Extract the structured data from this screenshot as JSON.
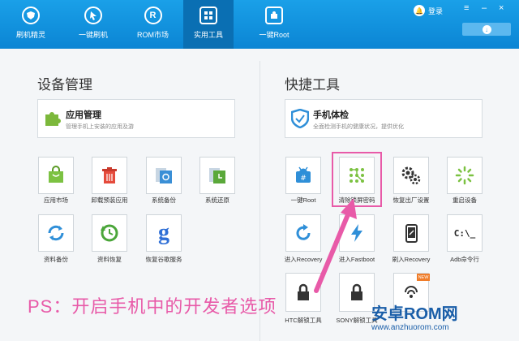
{
  "nav": [
    {
      "label": "刷机精灵",
      "icon": "shield-icon"
    },
    {
      "label": "一键刷机",
      "icon": "cursor-icon"
    },
    {
      "label": "ROM市场",
      "icon": "rom-icon",
      "glyph": "R"
    },
    {
      "label": "实用工具",
      "icon": "grid-icon",
      "active": true
    },
    {
      "label": "一键Root",
      "icon": "root-icon"
    }
  ],
  "header": {
    "login_label": "登录",
    "win_menu": "≡",
    "win_min": "–",
    "win_close": "×"
  },
  "device_mgmt": {
    "title": "设备管理",
    "card": {
      "title": "应用管理",
      "desc": "管理手机上安装的应用及游"
    },
    "tiles": [
      {
        "label": "应用市场",
        "icon": "shopping-bag-icon"
      },
      {
        "label": "卸载预装应用",
        "icon": "trash-icon"
      },
      {
        "label": "系统备份",
        "icon": "system-backup-icon"
      },
      {
        "label": "系统还原",
        "icon": "system-restore-icon"
      },
      {
        "label": "资料备份",
        "icon": "sync-icon"
      },
      {
        "label": "资料恢复",
        "icon": "history-icon"
      },
      {
        "label": "恢复谷歌服务",
        "icon": "google-icon"
      }
    ]
  },
  "quick_tools": {
    "title": "快捷工具",
    "card": {
      "title": "手机体检",
      "desc": "全面检测手机的健康状况，提供优化"
    },
    "tiles": [
      {
        "label": "一键Root",
        "icon": "android-root-icon"
      },
      {
        "label": "清除锁屏密码",
        "icon": "pattern-lock-icon"
      },
      {
        "label": "恢复出厂设置",
        "icon": "gears-icon"
      },
      {
        "label": "重启设备",
        "icon": "loading-spinner-icon"
      },
      {
        "label": "进入Recovery",
        "icon": "refresh-icon"
      },
      {
        "label": "进入Fastboot",
        "icon": "lightning-icon"
      },
      {
        "label": "刷入Recovery",
        "icon": "phone-icon"
      },
      {
        "label": "Adb命令行",
        "icon": "terminal-icon",
        "glyph": "C:\\_"
      },
      {
        "label": "HTC解锁工具",
        "icon": "lock-icon"
      },
      {
        "label": "SONY解锁工具",
        "icon": "lock-icon"
      }
    ],
    "new_badge": "NEW"
  },
  "overlay": {
    "ps_text": "PS：开启手机中的开发者选项",
    "watermark_title": "安卓ROM网",
    "watermark_url": "www.anzhuorom.com"
  },
  "colors": {
    "primary": "#0b85d4",
    "highlight": "#e85aa8",
    "watermark": "#1a5ea8"
  }
}
